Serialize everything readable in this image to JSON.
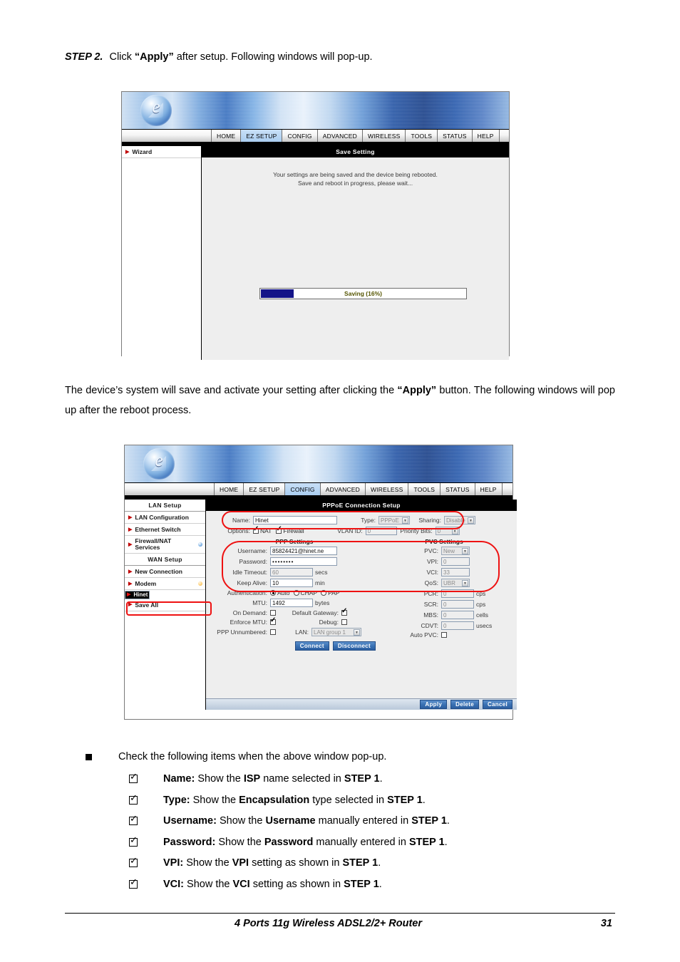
{
  "document": {
    "step": {
      "label": "STEP 2.",
      "text_before": "Click",
      "quoted": "“Apply”",
      "text_after": "after setup. Following windows will pop-up."
    },
    "paragraph": {
      "part1": "The device’s system will save and activate your setting after clicking the ",
      "bold": "“Apply”",
      "part2": " button. The following windows will pop up after the reboot process."
    },
    "bullet": "Check the following items when the above window pop-up.",
    "checks": [
      {
        "term": "Name:",
        "mid1": " Show the ",
        "strong1": "ISP",
        "mid2": " name selected in ",
        "strong2": "STEP 1",
        "end": "."
      },
      {
        "term": "Type:",
        "mid1": " Show the ",
        "strong1": "Encapsulation",
        "mid2": " type selected in ",
        "strong2": "STEP 1",
        "end": "."
      },
      {
        "term": "Username:",
        "mid1": " Show the ",
        "strong1": "Username",
        "mid2": " manually entered in ",
        "strong2": "STEP 1",
        "end": "."
      },
      {
        "term": "Password:",
        "mid1": " Show the ",
        "strong1": "Password",
        "mid2": " manually entered in ",
        "strong2": "STEP 1",
        "end": "."
      },
      {
        "term": "VPI:",
        "mid1": " Show the ",
        "strong1": "VPI",
        "mid2": " setting as shown in ",
        "strong2": "STEP 1",
        "end": "."
      },
      {
        "term": "VCI:",
        "mid1": " Show the ",
        "strong1": "VCI",
        "mid2": " setting as shown in ",
        "strong2": "STEP 1",
        "end": "."
      }
    ],
    "footer": {
      "title": "4 Ports 11g Wireless ADSL2/2+ Router",
      "page": "31"
    }
  },
  "router_ui": {
    "logo_glyph": "e",
    "nav_tabs": [
      "HOME",
      "EZ SETUP",
      "CONFIG",
      "ADVANCED",
      "WIRELESS",
      "TOOLS",
      "STATUS",
      "HELP"
    ],
    "screenshot_1": {
      "active_tab": "EZ SETUP",
      "sidebar": [
        {
          "label": "Wizard",
          "type": "link",
          "selected": false
        }
      ],
      "content_title": "Save Setting",
      "message_line1": "Your settings are being saved and the device being rebooted.",
      "message_line2": "Save and reboot in progress, please wait...",
      "progress": {
        "label": "Saving (16%)",
        "percent": 16,
        "fill_color": "#141488"
      }
    },
    "screenshot_2": {
      "active_tab": "CONFIG",
      "content_title": "PPPoE Connection Setup",
      "sidebar": [
        {
          "label": "LAN Setup",
          "type": "header"
        },
        {
          "label": "LAN Configuration",
          "type": "link"
        },
        {
          "label": "Ethernet Switch",
          "type": "link"
        },
        {
          "label": "Firewall/NAT Services",
          "type": "link",
          "dot": "blue"
        },
        {
          "label": "WAN Setup",
          "type": "header"
        },
        {
          "label": "New Connection",
          "type": "link"
        },
        {
          "label": "Modem",
          "type": "link",
          "dot": "orange"
        },
        {
          "label": "Hinet",
          "type": "link",
          "selected": true
        },
        {
          "label": "Save All",
          "type": "link"
        }
      ],
      "form": {
        "name_label": "Name:",
        "name_value": "Hinet",
        "type_label": "Type:",
        "type_value": "PPPoE",
        "sharing_label": "Sharing:",
        "sharing_value": "Disable",
        "options_label": "Options:",
        "nat_label": "NAT",
        "nat_checked": true,
        "firewall_label": "Firewall",
        "firewall_checked": true,
        "vlan_id_label": "VLAN ID:",
        "vlan_id_value": "0",
        "priority_bits_label": "Priority Bits:",
        "priority_bits_value": "0",
        "ppp_settings_header": "PPP Settings",
        "pvc_settings_header": "PVC Settings",
        "username_label": "Username:",
        "username_value": "85824421@hinet.ne",
        "password_label": "Password:",
        "password_value": "••••••••",
        "idle_timeout_label": "Idle Timeout:",
        "idle_timeout_value": "60",
        "idle_timeout_unit": "secs",
        "keep_alive_label": "Keep Alive:",
        "keep_alive_value": "10",
        "keep_alive_unit": "min",
        "authentication_label": "Authentication:",
        "auth_options": [
          "Auto",
          "CHAP",
          "PAP"
        ],
        "auth_selected": "Auto",
        "mtu_label": "MTU:",
        "mtu_value": "1492",
        "mtu_unit": "bytes",
        "on_demand_label": "On Demand:",
        "on_demand_checked": false,
        "default_gateway_label": "Default Gateway:",
        "default_gateway_checked": true,
        "enforce_mtu_label": "Enforce MTU:",
        "enforce_mtu_checked": true,
        "debug_label": "Debug:",
        "debug_checked": false,
        "ppp_unnumbered_label": "PPP Unnumbered:",
        "ppp_unnumbered_checked": false,
        "lan_label": "LAN:",
        "lan_value": "LAN group 1",
        "pvc_label": "PVC:",
        "pvc_value": "New",
        "vpi_label": "VPI:",
        "vpi_value": "0",
        "vci_label": "VCI:",
        "vci_value": "33",
        "qos_label": "QoS:",
        "qos_value": "UBR",
        "pcr_label": "PCR:",
        "pcr_value": "0",
        "pcr_unit": "cps",
        "scr_label": "SCR:",
        "scr_value": "0",
        "scr_unit": "cps",
        "mbs_label": "MBS:",
        "mbs_value": "0",
        "mbs_unit": "cells",
        "cdvt_label": "CDVT:",
        "cdvt_value": "0",
        "cdvt_unit": "usecs",
        "auto_pvc_label": "Auto PVC:",
        "auto_pvc_checked": false,
        "connect_label": "Connect",
        "disconnect_label": "Disconnect",
        "apply_label": "Apply",
        "delete_label": "Delete",
        "cancel_label": "Cancel"
      },
      "annotation_color": "#ee1111"
    }
  }
}
